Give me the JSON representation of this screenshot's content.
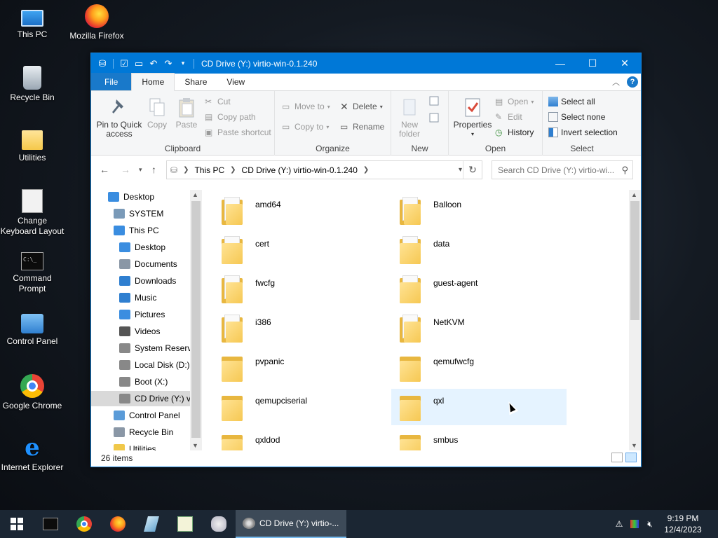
{
  "desktop": {
    "icons": [
      {
        "label": "This PC"
      },
      {
        "label": "Mozilla Firefox"
      },
      {
        "label": "Recycle Bin"
      },
      {
        "label": "Utilities"
      },
      {
        "label": "Change Keyboard Layout"
      },
      {
        "label": "Command Prompt"
      },
      {
        "label": "Control Panel"
      },
      {
        "label": "Google Chrome"
      },
      {
        "label": "Internet Explorer"
      }
    ]
  },
  "window": {
    "title": "CD Drive (Y:) virtio-win-0.1.240",
    "tabs": {
      "file": "File",
      "home": "Home",
      "share": "Share",
      "view": "View"
    },
    "ribbon": {
      "clipboard": {
        "label": "Clipboard",
        "pin": "Pin to Quick access",
        "copy": "Copy",
        "paste": "Paste",
        "cut": "Cut",
        "copy_path": "Copy path",
        "paste_shortcut": "Paste shortcut"
      },
      "organize": {
        "label": "Organize",
        "move_to": "Move to",
        "copy_to": "Copy to",
        "delete": "Delete",
        "rename": "Rename"
      },
      "new": {
        "label": "New",
        "new_folder": "New folder"
      },
      "open": {
        "label": "Open",
        "properties": "Properties",
        "open": "Open",
        "edit": "Edit",
        "history": "History"
      },
      "select": {
        "label": "Select",
        "select_all": "Select all",
        "select_none": "Select none",
        "invert": "Invert selection"
      }
    },
    "address": {
      "crumbs": [
        "This PC",
        "CD Drive (Y:) virtio-win-0.1.240"
      ]
    },
    "search": {
      "placeholder": "Search CD Drive (Y:) virtio-wi..."
    },
    "nav": [
      {
        "label": "Desktop",
        "indent": 0
      },
      {
        "label": "SYSTEM",
        "indent": 1
      },
      {
        "label": "This PC",
        "indent": 1
      },
      {
        "label": "Desktop",
        "indent": 2
      },
      {
        "label": "Documents",
        "indent": 2
      },
      {
        "label": "Downloads",
        "indent": 2
      },
      {
        "label": "Music",
        "indent": 2
      },
      {
        "label": "Pictures",
        "indent": 2
      },
      {
        "label": "Videos",
        "indent": 2
      },
      {
        "label": "System Reserve",
        "indent": 2
      },
      {
        "label": "Local Disk (D:)",
        "indent": 2
      },
      {
        "label": "Boot (X:)",
        "indent": 2
      },
      {
        "label": "CD Drive (Y:) vi",
        "indent": 2,
        "selected": true
      },
      {
        "label": "Control Panel",
        "indent": 1
      },
      {
        "label": "Recycle Bin",
        "indent": 1
      },
      {
        "label": "Utilities",
        "indent": 1
      }
    ],
    "folders": [
      {
        "name": "amd64",
        "kind": "docs"
      },
      {
        "name": "Balloon",
        "kind": "docs"
      },
      {
        "name": "cert",
        "kind": "paper"
      },
      {
        "name": "data",
        "kind": "paper"
      },
      {
        "name": "fwcfg",
        "kind": "docs"
      },
      {
        "name": "guest-agent",
        "kind": "paper"
      },
      {
        "name": "i386",
        "kind": "docs"
      },
      {
        "name": "NetKVM",
        "kind": "docs"
      },
      {
        "name": "pvpanic",
        "kind": "plain"
      },
      {
        "name": "qemufwcfg",
        "kind": "plain"
      },
      {
        "name": "qemupciserial",
        "kind": "plain"
      },
      {
        "name": "qxl",
        "kind": "plain",
        "hover": true
      },
      {
        "name": "qxldod",
        "kind": "plain"
      },
      {
        "name": "smbus",
        "kind": "plain"
      }
    ],
    "status": "26 items"
  },
  "taskbar": {
    "active_window": "CD Drive (Y:) virtio-...",
    "time": "9:19 PM",
    "date": "12/4/2023"
  }
}
